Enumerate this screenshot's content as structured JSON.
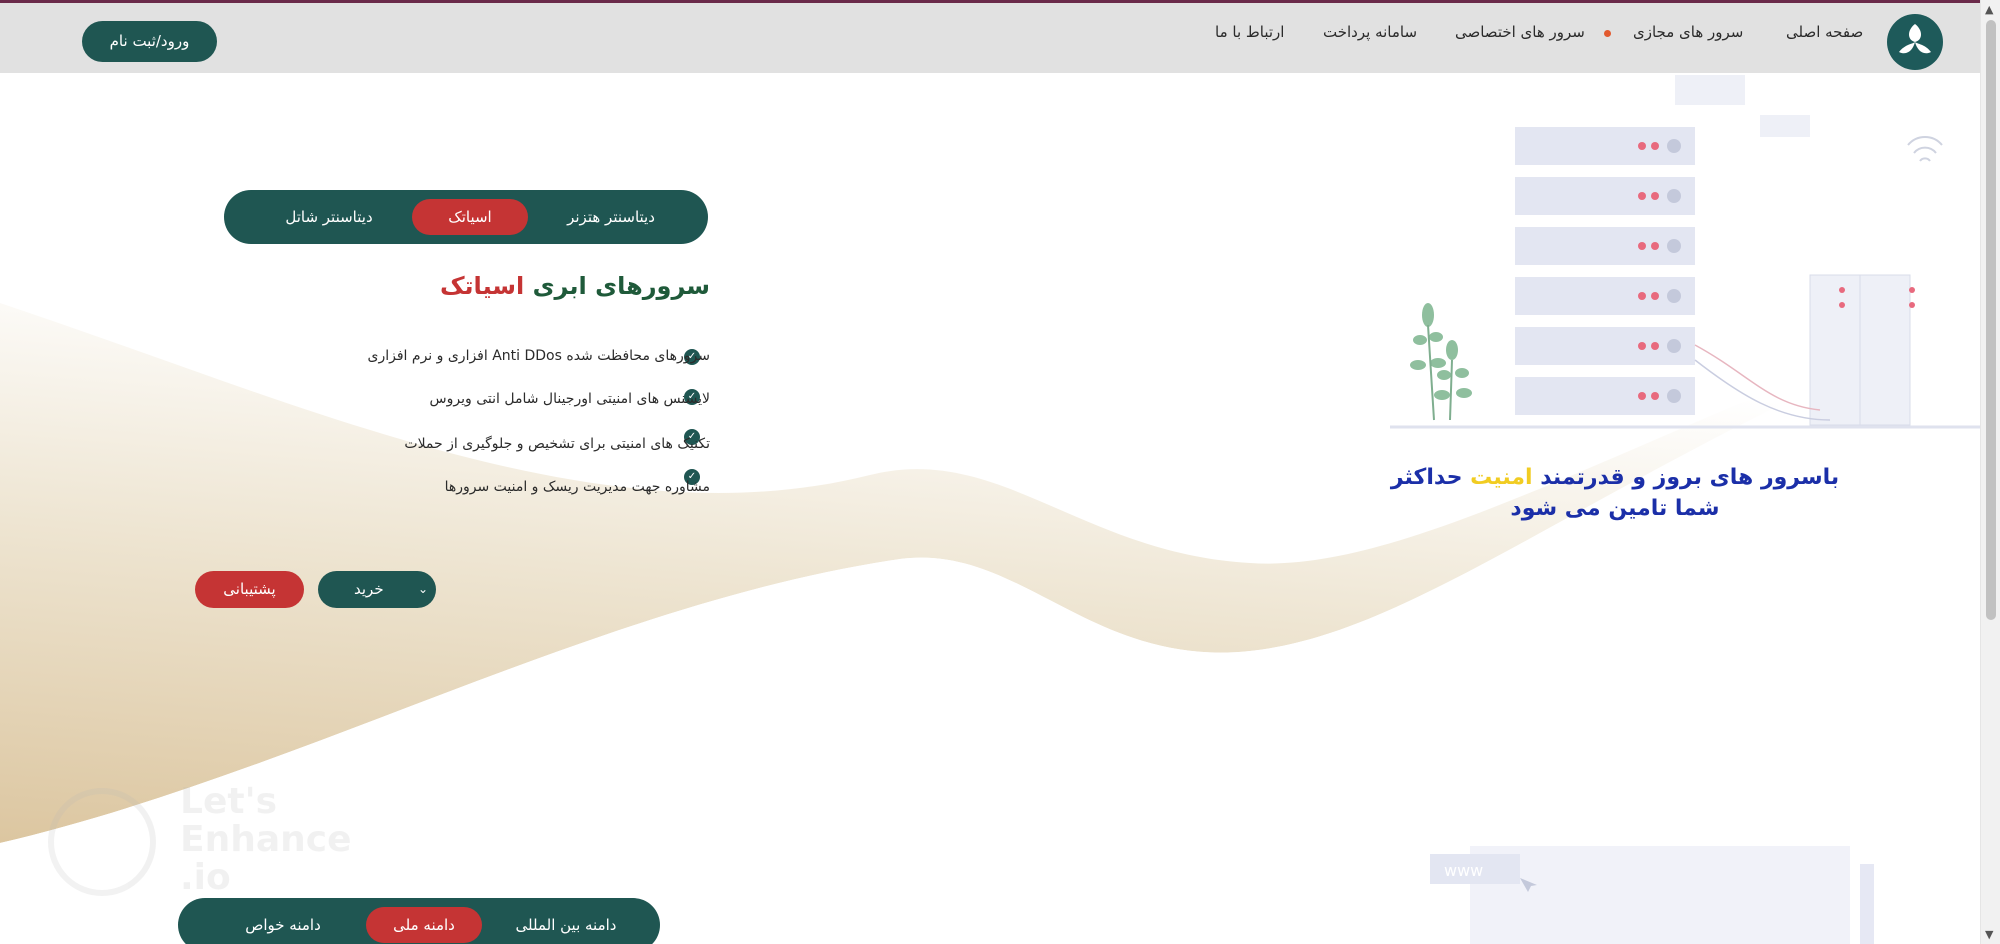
{
  "nav": {
    "home": "صفحه اصلی",
    "virtual_servers": "سرور های مجازی",
    "dedicated_servers": "سرور های اختصاصی",
    "payment_system": "سامانه پرداخت",
    "contact": "ارتباط با ما",
    "login_button": "ورود/ثبت نام"
  },
  "server_tabs": [
    {
      "label": "دیتاسنتر هتزنر",
      "active": false
    },
    {
      "label": "اسیاتک",
      "active": true
    },
    {
      "label": "دیتاسنتر شاتل",
      "active": false
    }
  ],
  "heading": {
    "prefix": "سرورهای ابری",
    "accent": "اسیاتک"
  },
  "features": [
    "سرورهای محافظت شده Anti DDos افزاری و نرم افزاری",
    "لایسنس های امنیتی اورجینال شامل انتی ویروس",
    "تکنیک های امنیتی برای تشخیص و جلوگیری از حملات",
    "مشاوره جهت مدیریت ریسک و امنیت سرورها"
  ],
  "actions": {
    "support": "پشتیبانی",
    "buy": "خرید"
  },
  "tagline": {
    "part1": "باسرور های بروز و قدرتمند",
    "highlight": "امنیت",
    "part2": "حداکثر",
    "line2": "شما تامین می شود"
  },
  "domain_tabs": [
    {
      "label": "دامنه بین المللی",
      "active": false
    },
    {
      "label": "دامنه ملی",
      "active": true
    },
    {
      "label": "دامنه خواص",
      "active": false
    }
  ],
  "watermark": {
    "line1": "Let's",
    "line2": "Enhance",
    "line3": ".io"
  },
  "colors": {
    "primary": "#1f5652",
    "accent_red": "#c53434",
    "tagline_blue": "#1b2fa8",
    "tagline_yellow": "#f1cc22",
    "wave_beige": "#e6d9bd",
    "topbar": "#e1e1e1"
  }
}
